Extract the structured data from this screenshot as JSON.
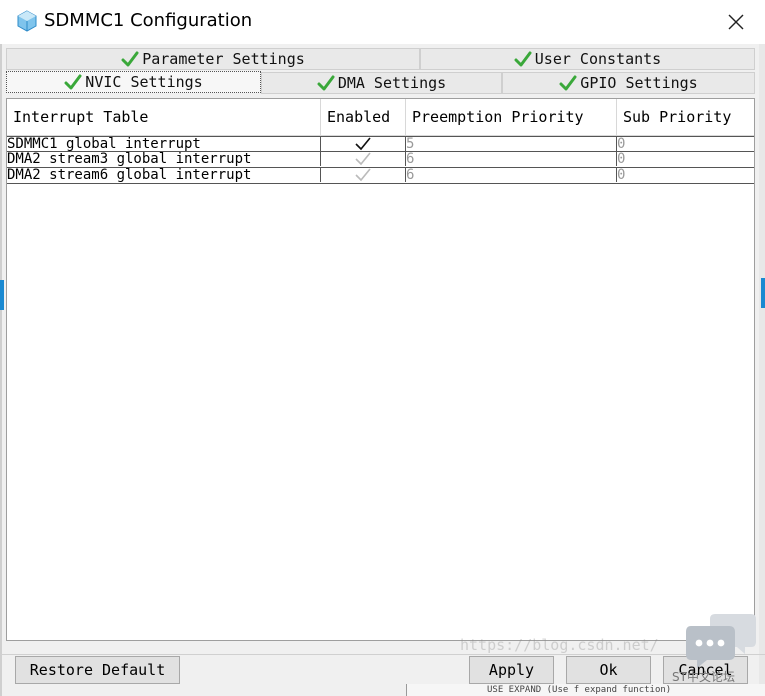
{
  "window": {
    "title": "SDMMC1 Configuration"
  },
  "tabs": {
    "row1": [
      {
        "label": "Parameter Settings"
      },
      {
        "label": "User Constants"
      }
    ],
    "row2": [
      {
        "label": "NVIC Settings",
        "active": true
      },
      {
        "label": "DMA Settings"
      },
      {
        "label": "GPIO Settings"
      }
    ]
  },
  "table": {
    "columns": [
      "Interrupt Table",
      "Enabled",
      "Preemption Priority",
      "Sub Priority"
    ],
    "rows": [
      {
        "name": "SDMMC1 global interrupt",
        "enabled": true,
        "enabled_editable": true,
        "preemption": "5",
        "sub": "0"
      },
      {
        "name": "DMA2 stream3 global interrupt",
        "enabled": true,
        "enabled_editable": false,
        "preemption": "6",
        "sub": "0"
      },
      {
        "name": "DMA2 stream6 global interrupt",
        "enabled": true,
        "enabled_editable": false,
        "preemption": "6",
        "sub": "0"
      }
    ]
  },
  "buttons": {
    "restore": "Restore Default",
    "apply": "Apply",
    "ok": "Ok",
    "cancel": "Cancel"
  },
  "overlay": {
    "watermark": "https://blog.csdn.net/",
    "chat_label": "ST中文论坛",
    "background_text": "USE EXPAND (Use f expand function)"
  },
  "colors": {
    "check_green": "#3aa83a",
    "accent_blue": "#1a89d1"
  }
}
